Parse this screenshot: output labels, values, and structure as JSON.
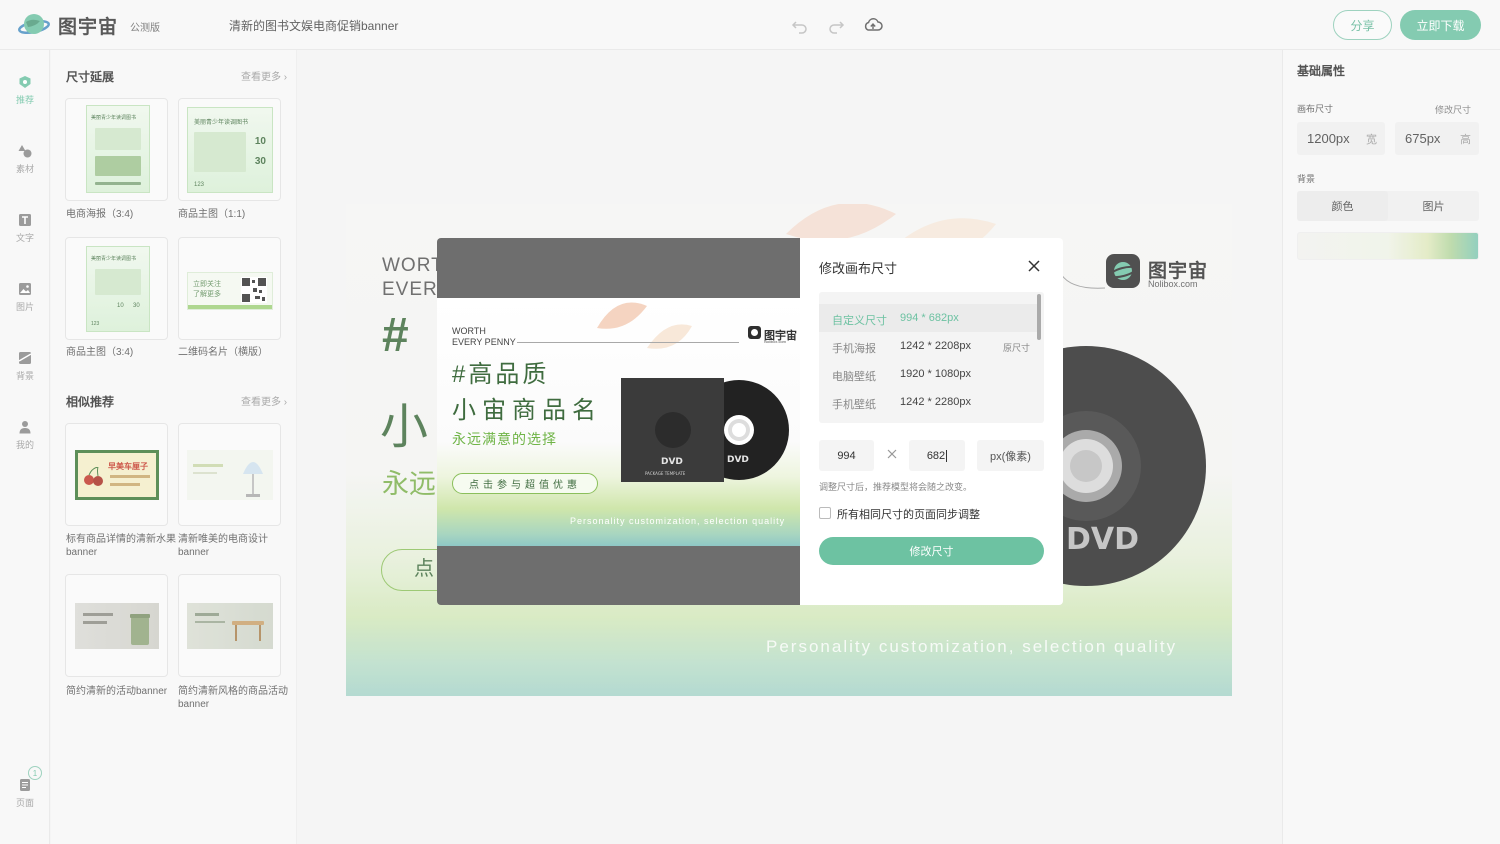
{
  "app": {
    "brand": "图宇宙",
    "beta_label": "公测版",
    "doc_title": "清新的图书文娱电商促销banner",
    "share_label": "分享",
    "download_label": "立即下载",
    "colors": {
      "accent": "#6dc2a2",
      "dark_green": "#3f6c3f",
      "light_green": "#7bb04c"
    }
  },
  "rail": {
    "items": [
      {
        "label": "推荐",
        "icon": "recommend-icon"
      },
      {
        "label": "素材",
        "icon": "shapes-icon"
      },
      {
        "label": "文字",
        "icon": "text-icon"
      },
      {
        "label": "图片",
        "icon": "image-icon"
      },
      {
        "label": "背景",
        "icon": "background-icon"
      },
      {
        "label": "我的",
        "icon": "user-icon"
      }
    ],
    "pages_label": "页面",
    "pages_count": "1"
  },
  "panel": {
    "size_section": {
      "title": "尺寸延展",
      "more": "查看更多",
      "items": [
        {
          "caption": "电商海报（3:4)"
        },
        {
          "caption": "商品主图（1:1)"
        },
        {
          "caption": "商品主图（3:4)"
        },
        {
          "caption": "二维码名片（横版）"
        }
      ]
    },
    "similar_section": {
      "title": "相似推荐",
      "more": "查看更多",
      "items": [
        {
          "caption": "标有商品详情的清新水果banner"
        },
        {
          "caption": "清新唯美的电商设计banner"
        },
        {
          "caption": "简约清新的活动banner"
        },
        {
          "caption": "简约清新风格的商品活动banner"
        }
      ]
    },
    "thumb_text": {
      "poster_title": "美丽青少年读调图书",
      "num_10": "10",
      "num_30": "30",
      "num_123": "123",
      "qr_line1": "立即关注",
      "qr_line2": "了解更多",
      "fruit_title": "早美车厘子"
    }
  },
  "canvas": {
    "worth_line1": "WORT",
    "worth_line2": "EVERY",
    "hash": "#",
    "small": "小",
    "yong": "永远",
    "btn": "点",
    "brand_name": "图宇宙",
    "brand_url": "Nolibox.com",
    "quality": "Personality customization, selection quality",
    "dvd_label": "DVD"
  },
  "props": {
    "title": "基础属性",
    "canvas_size_label": "画布尺寸",
    "modify_size_link": "修改尺寸",
    "width_value": "1200px",
    "width_unit": "宽",
    "height_value": "675px",
    "height_unit": "高",
    "background_label": "背景",
    "tabs": [
      {
        "label": "颜色"
      },
      {
        "label": "图片"
      }
    ]
  },
  "preview": {
    "worth_line1": "WORTH",
    "worth_line2": "EVERY PENNY",
    "headline1": "#高品质",
    "headline2": "小宙商品名",
    "subline": "永远满意的选择",
    "cta": "点击参与超值优惠",
    "quality": "Personality customization, selection quality",
    "logo_name": "图宇宙",
    "logo_url": "Nolibox.com",
    "dvd": "DVD",
    "package": "PACKAGE TEMPLATE"
  },
  "modal": {
    "title": "修改画布尺寸",
    "presets": [
      {
        "name": "自定义尺寸",
        "size": "994 * 682px",
        "selected": true,
        "note": ""
      },
      {
        "name": "手机海报",
        "size": "1242 * 2208px",
        "selected": false,
        "note": "原尺寸"
      },
      {
        "name": "电脑壁纸",
        "size": "1920 * 1080px",
        "selected": false,
        "note": ""
      },
      {
        "name": "手机壁纸",
        "size": "1242 * 2280px",
        "selected": false,
        "note": ""
      }
    ],
    "width_input": "994",
    "height_input": "682",
    "unit_label": "px(像素)",
    "hint": "调整尺寸后，推荐模型将会随之改变。",
    "sync_label": "所有相同尺寸的页面同步调整",
    "sync_checked": false,
    "submit_label": "修改尺寸"
  }
}
